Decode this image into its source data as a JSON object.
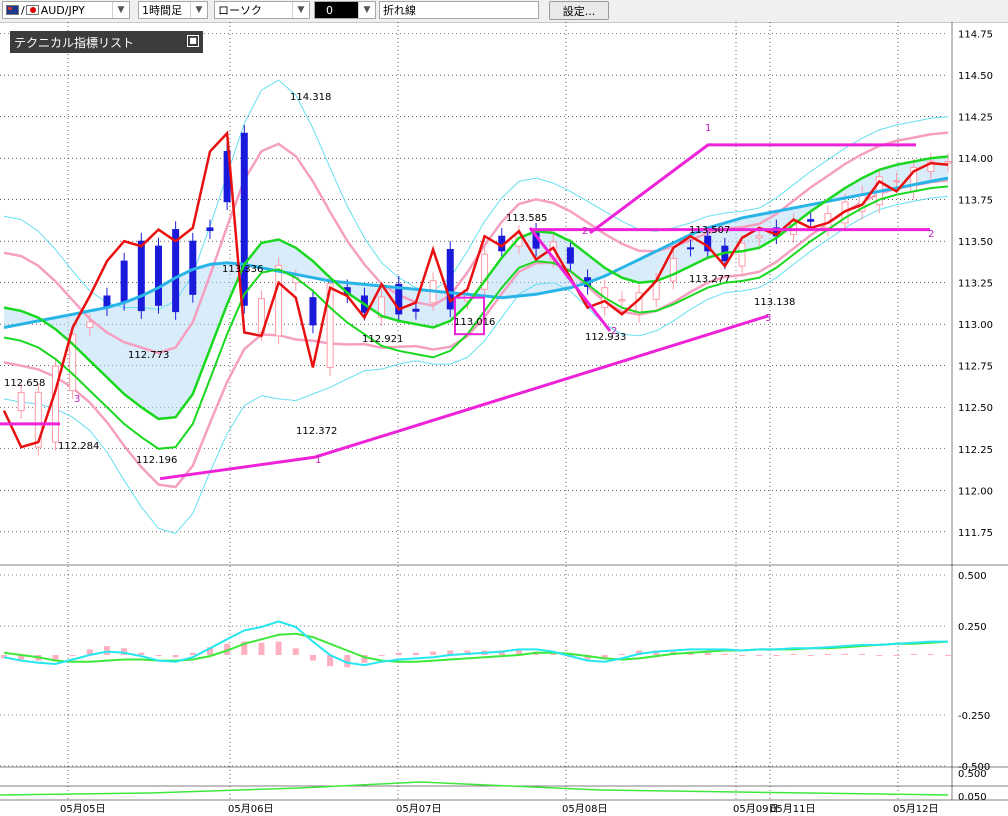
{
  "toolbar": {
    "symbol": "AUD/JPY",
    "timeframe": "1時間足",
    "chart_style": "ローソク",
    "value_field": "0",
    "line_mode": "折れ線",
    "settings_label": "設定..."
  },
  "indicator_panel": {
    "title": "テクニカル指標リスト"
  },
  "colors": {
    "candle_up": "#ff9aa8",
    "candle_down": "#1a1adb",
    "bollinger_outer": "#66e0f0",
    "bollinger_inner": "#f5a0c0",
    "moving_average_fast": "#19d81f",
    "moving_average_slow": "#29b4e8",
    "ichimoku_cloud": "#b8dcf5",
    "ichimoku_cloud_bear": "#f8c8d8",
    "price_line": "#e81010",
    "trendline": "#ee22d8",
    "macd": "#27e6ef",
    "macd_signal": "#3ee83a",
    "macd_histogram": "#ffb0c0",
    "grid": "#000000"
  },
  "chart_data": {
    "type": "line",
    "main_panel": {
      "y_range": [
        111.55,
        114.82
      ],
      "y_ticks": [
        "114.75",
        "114.50",
        "114.25",
        "114.00",
        "113.75",
        "113.50",
        "113.25",
        "113.00",
        "112.75",
        "112.50",
        "112.25",
        "112.00",
        "111.75"
      ],
      "x_ticks": [
        "05月05日",
        "05月06日",
        "05月07日",
        "05月08日",
        "05月09日",
        "05月11日",
        "05月12日"
      ],
      "annotations": [
        {
          "text": "114.318",
          "price": 114.318
        },
        {
          "text": "113.585",
          "price": 113.585
        },
        {
          "text": "113.507",
          "price": 113.507
        },
        {
          "text": "113.336",
          "price": 113.336
        },
        {
          "text": "113.277",
          "price": 113.277
        },
        {
          "text": "113.138",
          "price": 113.138
        },
        {
          "text": "113.016",
          "price": 113.016
        },
        {
          "text": "112.933",
          "price": 112.933
        },
        {
          "text": "112.921",
          "price": 112.921
        },
        {
          "text": "112.773",
          "price": 112.773
        },
        {
          "text": "112.658",
          "price": 112.658
        },
        {
          "text": "112.372",
          "price": 112.372
        },
        {
          "text": "112.284",
          "price": 112.284
        },
        {
          "text": "112.196",
          "price": 112.196
        },
        {
          "text": "1"
        },
        {
          "text": "2"
        },
        {
          "text": "3"
        },
        {
          "text": "4"
        }
      ],
      "price_line": [
        112.48,
        112.26,
        112.29,
        112.6,
        112.98,
        113.17,
        113.38,
        113.5,
        113.47,
        113.57,
        113.5,
        113.58,
        114.04,
        114.15,
        112.95,
        112.93,
        113.25,
        113.16,
        112.74,
        113.22,
        113.17,
        113.04,
        113.24,
        113.09,
        113.13,
        113.45,
        113.14,
        113.21,
        113.53,
        113.47,
        113.56,
        113.39,
        113.46,
        113.28,
        113.1,
        113.14,
        113.06,
        113.15,
        113.26,
        113.46,
        113.53,
        113.47,
        113.35,
        113.52,
        113.58,
        113.54,
        113.63,
        113.58,
        113.61,
        113.68,
        113.72,
        113.86,
        113.8,
        113.92,
        113.97,
        113.96
      ],
      "series": [
        {
          "name": "MA",
          "values": [
            113.1,
            113.08,
            113.04,
            112.97,
            112.88,
            112.78,
            112.68,
            112.58,
            112.5,
            112.43,
            112.44,
            112.58,
            112.85,
            113.12,
            113.36,
            113.49,
            113.51,
            113.46,
            113.38,
            113.28,
            113.19,
            113.12,
            113.05,
            113.02,
            113.0,
            112.98,
            113.02,
            113.12,
            113.26,
            113.4,
            113.52,
            113.56,
            113.55,
            113.5,
            113.42,
            113.34,
            113.28,
            113.25,
            113.26,
            113.3,
            113.35,
            113.4,
            113.43,
            113.44,
            113.46,
            113.52,
            113.6,
            113.68,
            113.75,
            113.82,
            113.88,
            113.93,
            113.96,
            113.98,
            114.0,
            114.01
          ]
        },
        {
          "name": "MA2",
          "values": [
            112.98,
            113.0,
            113.02,
            113.04,
            113.06,
            113.08,
            113.1,
            113.13,
            113.17,
            113.22,
            113.28,
            113.33,
            113.36,
            113.37,
            113.36,
            113.34,
            113.32,
            113.3,
            113.28,
            113.26,
            113.25,
            113.24,
            113.23,
            113.22,
            113.21,
            113.2,
            113.19,
            113.18,
            113.17,
            113.16,
            113.17,
            113.18,
            113.2,
            113.22,
            113.25,
            113.29,
            113.34,
            113.39,
            113.44,
            113.49,
            113.54,
            113.58,
            113.61,
            113.64,
            113.66,
            113.68,
            113.7,
            113.72,
            113.74,
            113.76,
            113.78,
            113.8,
            113.82,
            113.84,
            113.86,
            113.88
          ]
        }
      ]
    },
    "macd_panel": {
      "y_ticks": [
        "0.500",
        "0.250",
        "-0.250",
        "-0.500"
      ],
      "macd": [
        -0.02,
        -0.05,
        -0.07,
        -0.08,
        -0.04,
        0.0,
        0.03,
        0.02,
        -0.01,
        -0.05,
        -0.06,
        -0.02,
        0.06,
        0.14,
        0.22,
        0.25,
        0.3,
        0.25,
        0.12,
        0.0,
        -0.07,
        -0.09,
        -0.06,
        -0.04,
        -0.03,
        -0.02,
        0.0,
        0.01,
        0.02,
        0.03,
        0.05,
        0.05,
        0.03,
        -0.01,
        -0.05,
        -0.06,
        -0.03,
        0.01,
        0.03,
        0.04,
        0.05,
        0.05,
        0.05,
        0.04,
        0.05,
        0.05,
        0.06,
        0.06,
        0.07,
        0.08,
        0.09,
        0.09,
        0.1,
        0.11,
        0.12,
        0.12
      ],
      "signal": [
        0.02,
        0.0,
        -0.02,
        -0.05,
        -0.06,
        -0.06,
        -0.05,
        -0.04,
        -0.04,
        -0.05,
        -0.05,
        -0.04,
        -0.01,
        0.04,
        0.1,
        0.14,
        0.18,
        0.19,
        0.16,
        0.1,
        0.04,
        -0.02,
        -0.05,
        -0.06,
        -0.06,
        -0.05,
        -0.04,
        -0.03,
        -0.02,
        -0.01,
        0.0,
        0.02,
        0.02,
        0.01,
        -0.01,
        -0.03,
        -0.04,
        -0.03,
        -0.01,
        0.01,
        0.02,
        0.03,
        0.04,
        0.04,
        0.05,
        0.05,
        0.05,
        0.06,
        0.06,
        0.07,
        0.08,
        0.09,
        0.1,
        0.1,
        0.11,
        0.12
      ],
      "histogram": [
        -0.03,
        -0.04,
        -0.05,
        -0.05,
        0.0,
        0.05,
        0.08,
        0.06,
        0.02,
        -0.01,
        -0.02,
        0.02,
        0.07,
        0.1,
        0.12,
        0.11,
        0.12,
        0.06,
        -0.05,
        -0.1,
        -0.11,
        -0.07,
        -0.01,
        0.02,
        0.02,
        0.03,
        0.04,
        0.04,
        0.04,
        0.04,
        0.05,
        0.03,
        0.01,
        -0.02,
        -0.04,
        -0.03,
        0.01,
        0.04,
        0.04,
        0.03,
        0.03,
        0.02,
        0.01,
        0.0,
        0.0,
        0.0,
        0.01,
        0.0,
        0.01,
        0.01,
        0.01,
        0.0,
        0.0,
        0.01,
        0.01,
        0.0
      ]
    },
    "sub_panel": {
      "y_ticks": [
        "0.500",
        "0.050"
      ]
    }
  }
}
